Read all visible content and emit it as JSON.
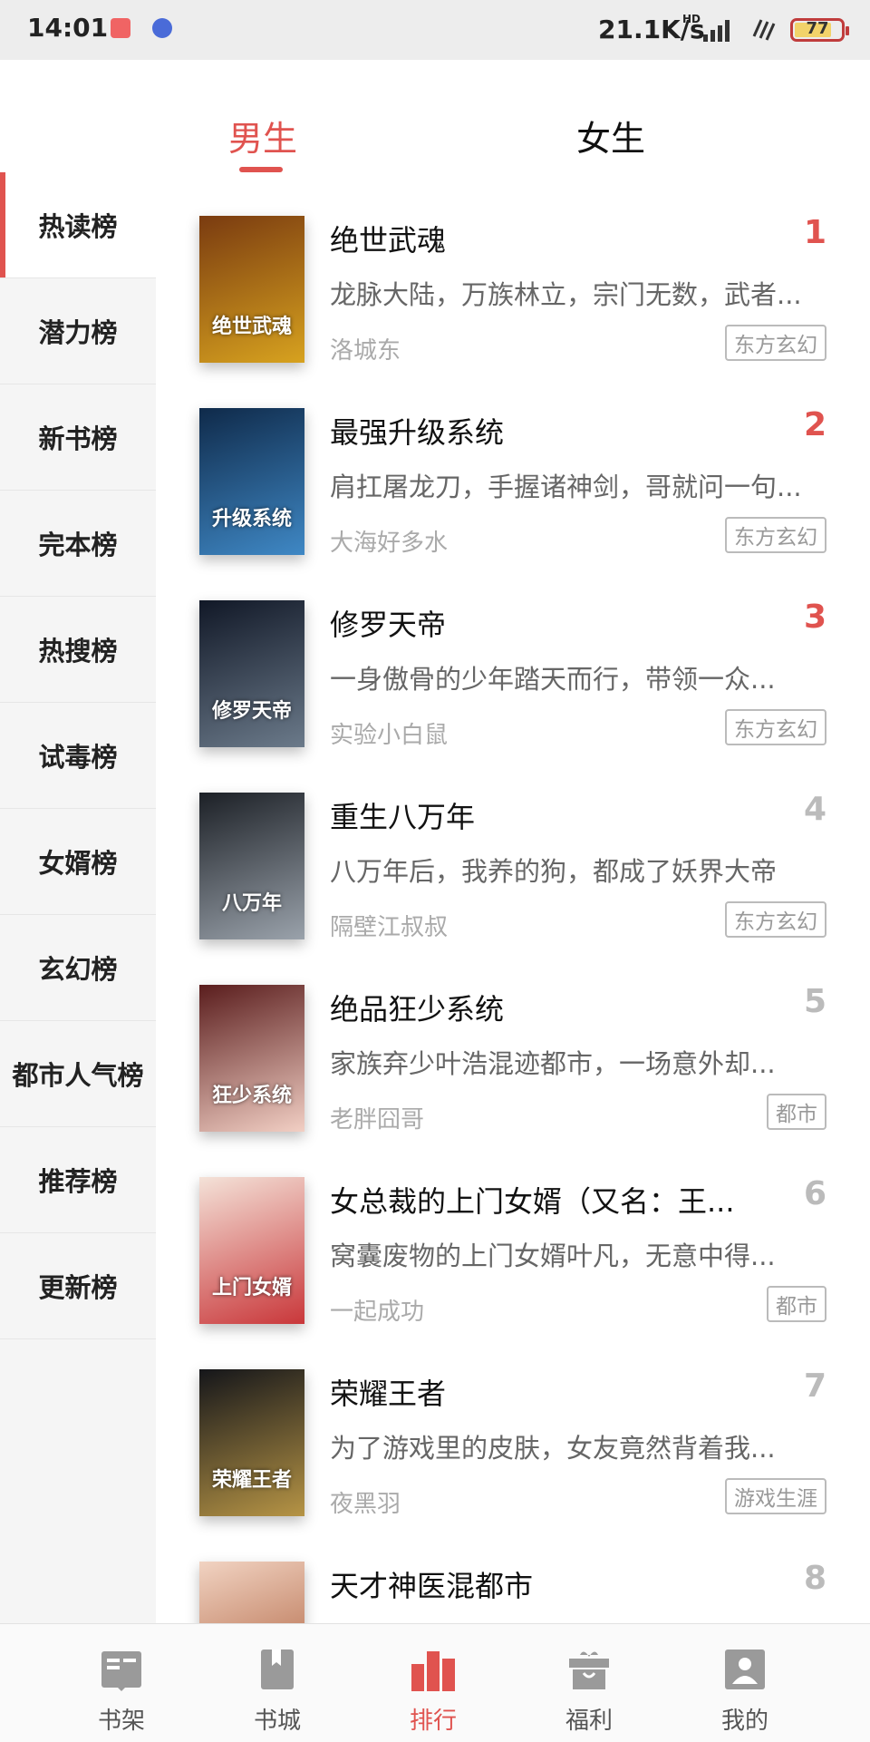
{
  "status_bar": {
    "time": "14:01",
    "net_speed": "21.1K/s",
    "hd_label": "HD",
    "battery": "77"
  },
  "gender_tabs": [
    {
      "label": "男生",
      "active": true
    },
    {
      "label": "女生",
      "active": false
    }
  ],
  "sidebar": {
    "items": [
      {
        "label": "热读榜"
      },
      {
        "label": "潜力榜"
      },
      {
        "label": "新书榜"
      },
      {
        "label": "完本榜"
      },
      {
        "label": "热搜榜"
      },
      {
        "label": "试毒榜"
      },
      {
        "label": "女婿榜"
      },
      {
        "label": "玄幻榜"
      },
      {
        "label": "都市人气榜"
      },
      {
        "label": "推荐榜"
      },
      {
        "label": "更新榜"
      }
    ]
  },
  "books": [
    {
      "title": "绝世武魂",
      "rank": "1",
      "desc": "龙脉大陆，万族林立，宗门无数，武者...",
      "author": "洛城东",
      "tag": "东方玄幻",
      "cover_text": "绝世武魂",
      "cover_colors": [
        "#7a3b10",
        "#d7a21f"
      ]
    },
    {
      "title": "最强升级系统",
      "rank": "2",
      "desc": "肩扛屠龙刀，手握诸神剑，哥就问一句...",
      "author": "大海好多水",
      "tag": "东方玄幻",
      "cover_text": "升级系统",
      "cover_colors": [
        "#0f2a4a",
        "#3f88c5"
      ]
    },
    {
      "title": "修罗天帝",
      "rank": "3",
      "desc": "一身傲骨的少年踏天而行，带领一众...",
      "author": "实验小白鼠",
      "tag": "东方玄幻",
      "cover_text": "修罗天帝",
      "cover_colors": [
        "#111827",
        "#6b7a8a"
      ]
    },
    {
      "title": "重生八万年",
      "rank": "4",
      "desc": "八万年后，我养的狗，都成了妖界大帝",
      "author": "隔壁江叔叔",
      "tag": "东方玄幻",
      "cover_text": "八万年",
      "cover_colors": [
        "#1c2026",
        "#9aa2ab"
      ]
    },
    {
      "title": "绝品狂少系统",
      "rank": "5",
      "desc": "家族弃少叶浩混迹都市，一场意外却...",
      "author": "老胖囧哥",
      "tag": "都市",
      "cover_text": "狂少系统",
      "cover_colors": [
        "#5a1d1d",
        "#f2cfc4"
      ]
    },
    {
      "title": "女总裁的上门女婿（又名：王...",
      "rank": "6",
      "desc": "窝囊废物的上门女婿叶凡，无意中得...",
      "author": "一起成功",
      "tag": "都市",
      "cover_text": "上门女婿",
      "cover_colors": [
        "#f4e2d8",
        "#c9373a"
      ]
    },
    {
      "title": "荣耀王者",
      "rank": "7",
      "desc": "为了游戏里的皮肤，女友竟然背着我...",
      "author": "夜黑羽",
      "tag": "游戏生涯",
      "cover_text": "荣耀王者",
      "cover_colors": [
        "#15161a",
        "#b69445"
      ]
    },
    {
      "title": "天才神医混都市",
      "rank": "8",
      "desc": "",
      "author": "",
      "tag": "",
      "cover_text": "",
      "cover_colors": [
        "#f1d3c2",
        "#a7542f"
      ]
    }
  ],
  "bottom_nav": [
    {
      "label": "书架",
      "icon": "bookshelf-icon",
      "active": false
    },
    {
      "label": "书城",
      "icon": "bookmark-book-icon",
      "active": false
    },
    {
      "label": "排行",
      "icon": "ranking-bars-icon",
      "active": true
    },
    {
      "label": "福利",
      "icon": "gift-icon",
      "active": false
    },
    {
      "label": "我的",
      "icon": "profile-icon",
      "active": false
    }
  ],
  "colors": {
    "accent": "#e0534f",
    "inactive_icon": "#9a9a9a"
  }
}
